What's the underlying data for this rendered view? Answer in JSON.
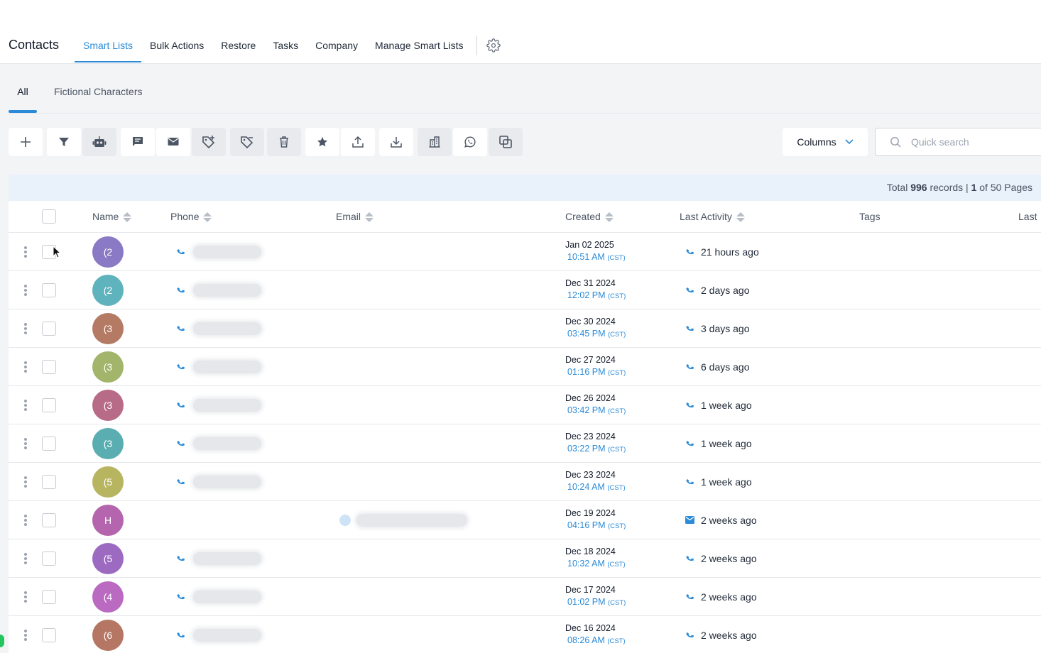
{
  "app": {
    "title": "Contacts"
  },
  "nav": {
    "tabs": [
      {
        "label": "Smart Lists",
        "active": true
      },
      {
        "label": "Bulk Actions"
      },
      {
        "label": "Restore"
      },
      {
        "label": "Tasks"
      },
      {
        "label": "Company"
      },
      {
        "label": "Manage Smart Lists"
      }
    ],
    "settings_icon": "gear-icon"
  },
  "subtabs": [
    {
      "label": "All",
      "active": true
    },
    {
      "label": "Fictional Characters"
    }
  ],
  "toolbar": {
    "buttons": [
      "add-icon",
      "filter-icon",
      "robot-icon",
      "message-icon",
      "email-icon",
      "add-tag-icon",
      "remove-tag-icon",
      "trash-icon",
      "star-icon",
      "export-icon",
      "import-icon",
      "company-icon",
      "whatsapp-icon",
      "duplicate-icon"
    ],
    "columns_label": "Columns",
    "search_placeholder": "Quick search"
  },
  "summary": {
    "prefix": "Total",
    "total": "996",
    "records_label": "records |",
    "page": "1",
    "of_label": "of 50 Pages"
  },
  "table": {
    "headers": {
      "name": "Name",
      "phone": "Phone",
      "email": "Email",
      "created": "Created",
      "last_activity": "Last Activity",
      "tags": "Tags",
      "last": "Last"
    },
    "rows": [
      {
        "initial": "(2",
        "color": "#8a79c4",
        "has_phone": true,
        "has_email": false,
        "date": "Jan 02 2025",
        "time": "10:51 AM",
        "tz": "(CST)",
        "activity_icon": "phone-icon",
        "activity": "21 hours ago"
      },
      {
        "initial": "(2",
        "color": "#5fb3bd",
        "has_phone": true,
        "has_email": false,
        "date": "Dec 31 2024",
        "time": "12:02 PM",
        "tz": "(CST)",
        "activity_icon": "phone-icon",
        "activity": "2 days ago"
      },
      {
        "initial": "(3",
        "color": "#b57a63",
        "has_phone": true,
        "has_email": false,
        "date": "Dec 30 2024",
        "time": "03:45 PM",
        "tz": "(CST)",
        "activity_icon": "phone-icon",
        "activity": "3 days ago"
      },
      {
        "initial": "(3",
        "color": "#a3b56b",
        "has_phone": true,
        "has_email": false,
        "date": "Dec 27 2024",
        "time": "01:16 PM",
        "tz": "(CST)",
        "activity_icon": "phone-icon",
        "activity": "6 days ago"
      },
      {
        "initial": "(3",
        "color": "#b86b86",
        "has_phone": true,
        "has_email": false,
        "date": "Dec 26 2024",
        "time": "03:42 PM",
        "tz": "(CST)",
        "activity_icon": "phone-icon",
        "activity": "1 week ago"
      },
      {
        "initial": "(3",
        "color": "#5aaeb1",
        "has_phone": true,
        "has_email": false,
        "date": "Dec 23 2024",
        "time": "03:22 PM",
        "tz": "(CST)",
        "activity_icon": "phone-icon",
        "activity": "1 week ago"
      },
      {
        "initial": "(5",
        "color": "#b8b560",
        "has_phone": true,
        "has_email": false,
        "date": "Dec 23 2024",
        "time": "10:24 AM",
        "tz": "(CST)",
        "activity_icon": "phone-icon",
        "activity": "1 week ago"
      },
      {
        "initial": "H",
        "color": "#b565ad",
        "has_phone": false,
        "has_email": true,
        "date": "Dec 19 2024",
        "time": "04:16 PM",
        "tz": "(CST)",
        "activity_icon": "email-icon",
        "activity": "2 weeks ago"
      },
      {
        "initial": "(5",
        "color": "#9d6ac2",
        "has_phone": true,
        "has_email": false,
        "date": "Dec 18 2024",
        "time": "10:32 AM",
        "tz": "(CST)",
        "activity_icon": "phone-icon",
        "activity": "2 weeks ago"
      },
      {
        "initial": "(4",
        "color": "#ba6bc1",
        "has_phone": true,
        "has_email": false,
        "date": "Dec 17 2024",
        "time": "01:02 PM",
        "tz": "(CST)",
        "activity_icon": "phone-icon",
        "activity": "2 weeks ago"
      },
      {
        "initial": "(6",
        "color": "#b57663",
        "has_phone": true,
        "has_email": false,
        "date": "Dec 16 2024",
        "time": "08:26 AM",
        "tz": "(CST)",
        "activity_icon": "phone-icon",
        "activity": "2 weeks ago"
      }
    ]
  }
}
